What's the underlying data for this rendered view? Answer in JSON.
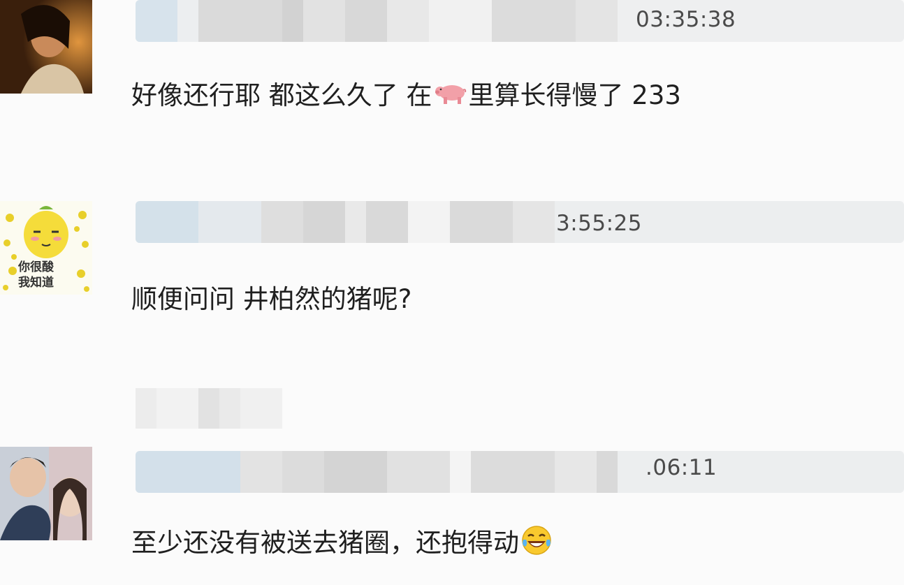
{
  "comments": [
    {
      "timestamp": "03:35:38",
      "text_before_emoji": "好像还行耶 都这么久了 在",
      "emoji": "pig-emoji",
      "text_after_emoji": "里算长得慢了 233"
    },
    {
      "timestamp": "3:55:25",
      "text": "顺便问问 井柏然的猪呢?",
      "avatar_caption_line1": "你很酸",
      "avatar_caption_line2": "我知道"
    },
    {
      "timestamp": ".06:11",
      "text": "至少还没有被送去猪圈，还抱得动",
      "emoji": "laughing-tears-emoji"
    }
  ],
  "colors": {
    "text": "#1f1f1f",
    "timestamp": "#4a4a4a",
    "blur_light": "#e6e8ea",
    "blur_blue": "#d5e2ec",
    "blur_mid": "#d8d8d8"
  }
}
